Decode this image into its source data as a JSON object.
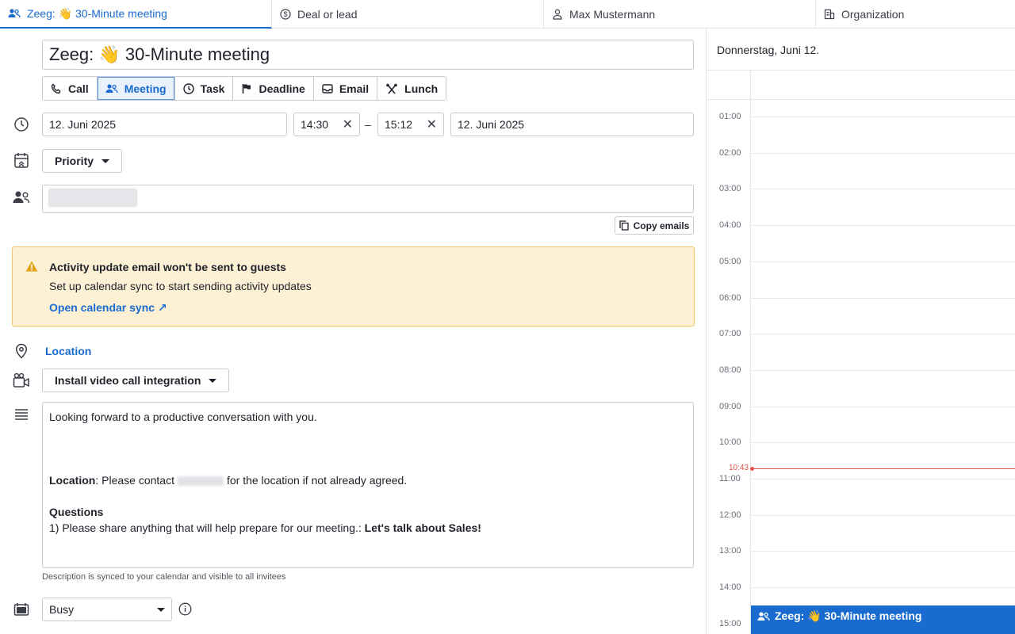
{
  "tabs": [
    {
      "label": "Zeeg: 👋 30-Minute meeting",
      "icon": "people-icon",
      "active": true
    },
    {
      "label": "Deal or lead",
      "icon": "dollar-icon",
      "active": false
    },
    {
      "label": "Max Mustermann",
      "icon": "person-icon",
      "active": false
    },
    {
      "label": "Organization",
      "icon": "building-icon",
      "active": false
    }
  ],
  "activity": {
    "title": "Zeeg: 👋 30-Minute meeting",
    "types": [
      {
        "label": "Call",
        "icon": "phone-icon"
      },
      {
        "label": "Meeting",
        "icon": "people-icon"
      },
      {
        "label": "Task",
        "icon": "clock-icon"
      },
      {
        "label": "Deadline",
        "icon": "flag-icon"
      },
      {
        "label": "Email",
        "icon": "inbox-icon"
      },
      {
        "label": "Lunch",
        "icon": "utensils-icon"
      }
    ],
    "start_date": "12. Juni 2025",
    "start_time": "14:30",
    "end_time": "15:12",
    "end_date": "12. Juni 2025",
    "range_separator": "–",
    "priority_label": "Priority",
    "copy_emails_label": "Copy emails",
    "location_label": "Location",
    "video_label": "Install video call integration",
    "description": {
      "line1": "Looking forward to a productive conversation with you.",
      "location_key": "Location",
      "location_pre": ": Please contact",
      "location_post": "for the location if not already agreed.",
      "questions_heading": "Questions",
      "question_text": "1) Please share anything that will help prepare for our meeting.:",
      "question_answer": "Let's talk about Sales!"
    },
    "description_note": "Description is synced to your calendar and visible to all invitees",
    "availability": "Busy"
  },
  "alert": {
    "title": "Activity update email won't be sent to guests",
    "text": "Set up calendar sync to start sending activity updates",
    "link": "Open calendar sync ↗",
    "bg_color": "#fcf1d4",
    "border_color": "#f0c462"
  },
  "calendar": {
    "date_label": "Donnerstag, Juni 12.",
    "hours": [
      "01:00",
      "02:00",
      "03:00",
      "04:00",
      "05:00",
      "06:00",
      "07:00",
      "08:00",
      "09:00",
      "10:00",
      "11:00",
      "12:00",
      "13:00",
      "14:00",
      "15:00"
    ],
    "now_time": "10:43",
    "event_title": "Zeeg: 👋 30-Minute meeting"
  },
  "colors": {
    "accent": "#1a6bcf",
    "now_line": "#e0554b"
  }
}
